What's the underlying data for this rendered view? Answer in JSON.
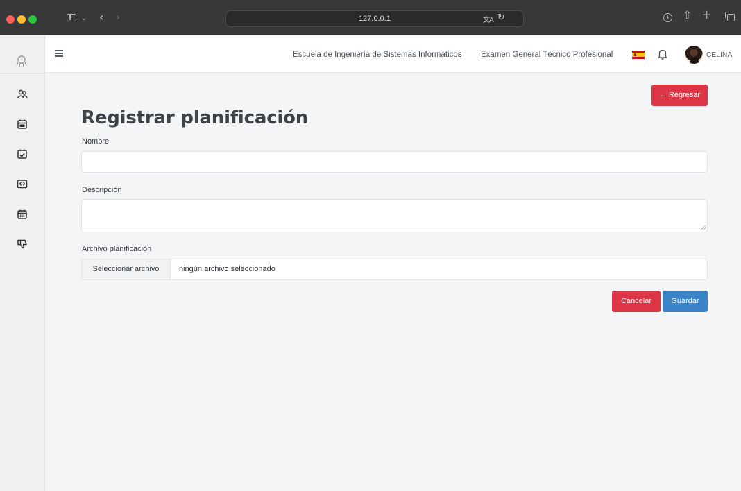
{
  "browser": {
    "url": "127.0.0.1",
    "traffic_lights": {
      "close": "#ff5f57",
      "minimize": "#febc2e",
      "zoom": "#28c840"
    },
    "icons": {
      "sidebar": "sidebar-icon",
      "tab_overview_menu": "chevron-down-icon",
      "back": "back-arrow-icon",
      "forward": "forward-arrow-icon",
      "translate": "translate-icon",
      "reload": "reload-icon",
      "downloads": "download-icon",
      "share": "share-icon",
      "new_tab": "plus-icon",
      "tab_overview": "tabs-icon"
    }
  },
  "sidebar": {
    "logo_icon": "rocket-icon",
    "items": [
      {
        "icon": "users-icon"
      },
      {
        "icon": "calendar-icon"
      },
      {
        "icon": "calendar-check-icon"
      },
      {
        "icon": "code-icon"
      },
      {
        "icon": "calendar-grid-icon"
      },
      {
        "icon": "thumbs-down-icon"
      }
    ]
  },
  "navbar": {
    "menu_icon": "hamburger-icon",
    "school_link": "Escuela de Ingeniería de Sistemas Informáticos",
    "exam_link": "Examen General Técnico Profesional",
    "language_flag": "spain-flag-icon",
    "notifications_icon": "bell-icon",
    "user_name": "CELINA"
  },
  "page": {
    "back_button": "← Regresar",
    "title": "Registrar planificación",
    "form": {
      "name_label": "Nombre",
      "name_value": "",
      "description_label": "Descripción",
      "description_value": "",
      "file_label": "Archivo planificación",
      "file_button": "Seleccionar archivo",
      "file_status": "ningún archivo seleccionado",
      "cancel_button": "Cancelar",
      "save_button": "Guardar"
    }
  },
  "colors": {
    "danger": "#dc3545",
    "primary": "#3a83c7",
    "background": "#f4f5f7",
    "titlebar": "#383838"
  }
}
